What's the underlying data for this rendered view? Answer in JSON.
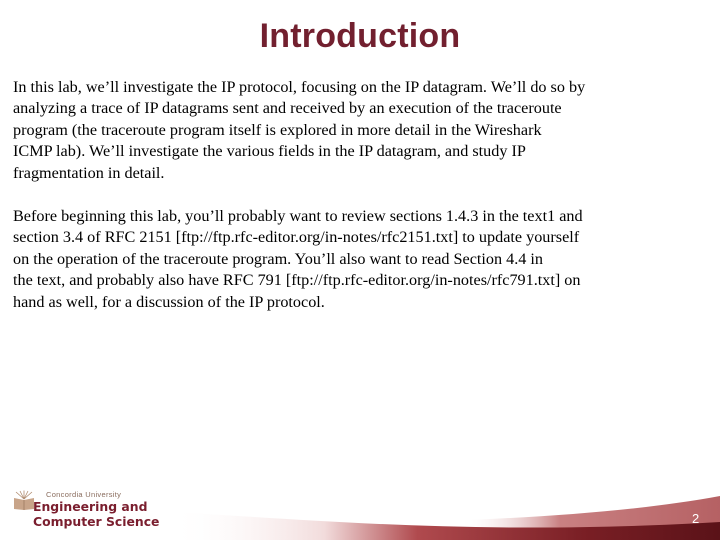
{
  "slide": {
    "title": "Introduction",
    "paragraphs": [
      {
        "lines": [
          "In this lab, we’ll investigate the IP protocol, focusing on the IP datagram. We’ll do so by",
          "analyzing a trace of IP datagrams sent and received by an execution of the traceroute",
          "program (the traceroute program itself is explored in more detail in the Wireshark",
          "ICMP lab). We’ll investigate the various fields in the IP datagram, and study IP",
          "fragmentation in detail."
        ]
      },
      {
        "lines": [
          "Before beginning this lab, you’ll probably want to review sections 1.4.3 in the text1 and",
          "section 3.4 of RFC 2151 [ftp://ftp.rfc-editor.org/in-notes/rfc2151.txt] to update yourself",
          "on the operation of the traceroute program. You’ll also want to read Section 4.4 in",
          "the text, and probably also have RFC 791 [ftp://ftp.rfc-editor.org/in-notes/rfc791.txt] on",
          "hand as well, for a discussion of the IP protocol."
        ]
      }
    ],
    "page_number": "2"
  },
  "footer": {
    "logo": {
      "university": "Concordia University",
      "line1": "Engineering and",
      "line2": "Computer Science",
      "icon": "book-sunrise-icon"
    }
  },
  "colors": {
    "title": "#72202f",
    "band_dark": "#5a1218",
    "band_mid": "#9b3a3e",
    "logo_text": "#7a1e2e"
  }
}
